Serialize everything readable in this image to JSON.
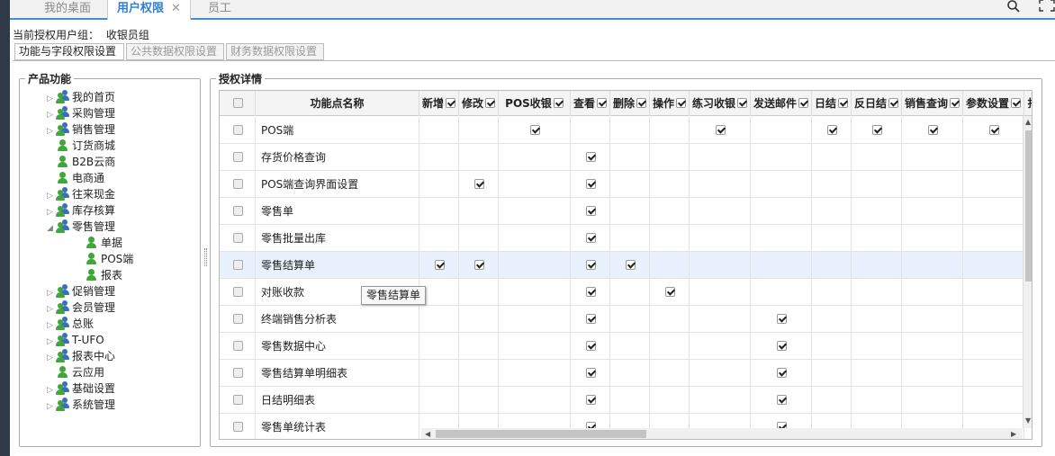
{
  "tabs": [
    {
      "label": "我的桌面"
    },
    {
      "label": "用户权限",
      "close": "✕"
    },
    {
      "label": "员工"
    }
  ],
  "current_group": {
    "label": "当前授权用户组：",
    "value": "收银员组"
  },
  "subtabs": [
    {
      "label": "功能与字段权限设置"
    },
    {
      "label": "公共数据权限设置"
    },
    {
      "label": "财务数据权限设置"
    }
  ],
  "left_panel": {
    "title": "产品功能",
    "items": [
      {
        "label": "我的首页",
        "arrow": "▷"
      },
      {
        "label": "采购管理",
        "arrow": "▷"
      },
      {
        "label": "销售管理",
        "arrow": "▷"
      },
      {
        "label": "订货商城",
        "arrow": ""
      },
      {
        "label": "B2B云商",
        "arrow": ""
      },
      {
        "label": "电商通",
        "arrow": ""
      },
      {
        "label": "往来现金",
        "arrow": "▷"
      },
      {
        "label": "库存核算",
        "arrow": "▷"
      },
      {
        "label": "零售管理",
        "arrow": "◢"
      },
      {
        "label": "单据",
        "arrow": ""
      },
      {
        "label": "POS端",
        "arrow": ""
      },
      {
        "label": "报表",
        "arrow": ""
      },
      {
        "label": "促销管理",
        "arrow": "▷"
      },
      {
        "label": "会员管理",
        "arrow": "▷"
      },
      {
        "label": "总账",
        "arrow": "▷"
      },
      {
        "label": "T-UFO",
        "arrow": "▷"
      },
      {
        "label": "报表中心",
        "arrow": "▷"
      },
      {
        "label": "云应用",
        "arrow": ""
      },
      {
        "label": "基础设置",
        "arrow": "▷"
      },
      {
        "label": "系统管理",
        "arrow": "▷"
      }
    ]
  },
  "right_panel": {
    "title": "授权详情",
    "name_header": "功能点名称",
    "columns": [
      {
        "label": "新增",
        "checked": true
      },
      {
        "label": "修改",
        "checked": true
      },
      {
        "label": "POS收银",
        "checked": true
      },
      {
        "label": "查看",
        "checked": true
      },
      {
        "label": "删除",
        "checked": true
      },
      {
        "label": "操作",
        "checked": true
      },
      {
        "label": "练习收银",
        "checked": true
      },
      {
        "label": "发送邮件",
        "checked": true
      },
      {
        "label": "日结",
        "checked": true
      },
      {
        "label": "反日结",
        "checked": true
      },
      {
        "label": "销售查询",
        "checked": true
      },
      {
        "label": "参数设置",
        "checked": true
      },
      {
        "label": "打",
        "checked": false
      }
    ],
    "rows": [
      {
        "name": "POS端",
        "checks": [
          2,
          6,
          8,
          9,
          10,
          11
        ]
      },
      {
        "name": "存货价格查询",
        "checks": [
          3
        ]
      },
      {
        "name": "POS端查询界面设置",
        "checks": [
          1,
          3
        ]
      },
      {
        "name": "零售单",
        "checks": [
          3
        ]
      },
      {
        "name": "零售批量出库",
        "checks": [
          3
        ]
      },
      {
        "name": "零售结算单",
        "checks": [
          0,
          1,
          3,
          4
        ]
      },
      {
        "name": "对账收款",
        "checks": [
          3,
          5
        ]
      },
      {
        "name": "终端销售分析表",
        "checks": [
          3,
          7
        ]
      },
      {
        "name": "零售数据中心",
        "checks": [
          3,
          7
        ]
      },
      {
        "name": "零售结算单明细表",
        "checks": [
          3,
          7
        ]
      },
      {
        "name": "日结明细表",
        "checks": [
          3,
          7
        ]
      },
      {
        "name": "零售单统计表",
        "checks": [
          3,
          7
        ]
      }
    ],
    "selected_row": 5,
    "tooltip": "零售结算单"
  },
  "icons": {
    "search": "search-icon",
    "expand": "fullscreen-icon"
  },
  "colors": {
    "accent": "#3f8fdb",
    "sidebar": "#2f3947",
    "selected_row": "#e9f2fc"
  }
}
